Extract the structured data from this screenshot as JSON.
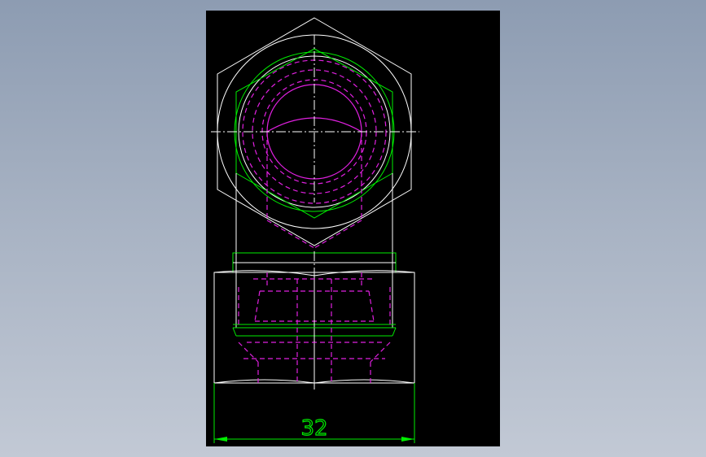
{
  "drawing": {
    "background": "#000000",
    "colors": {
      "outline": "#ffffff",
      "dimension": "#00ee00",
      "hidden": "#e020e0"
    },
    "dimension_label": "32"
  }
}
